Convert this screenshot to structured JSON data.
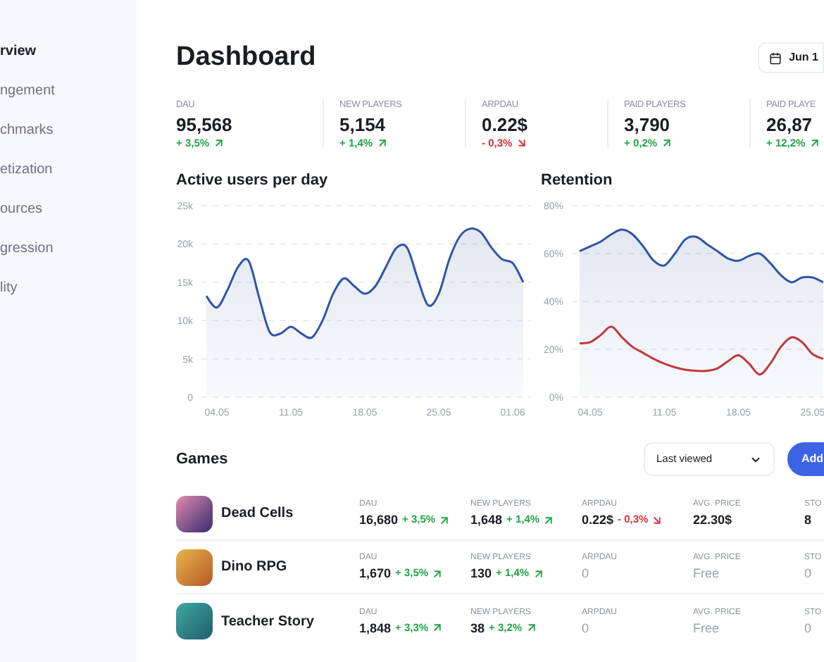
{
  "sidebar": {
    "items": [
      {
        "label": "rview",
        "selected": true
      },
      {
        "label": "ngement",
        "selected": false
      },
      {
        "label": "chmarks",
        "selected": false
      },
      {
        "label": "etization",
        "selected": false
      },
      {
        "label": "ources",
        "selected": false
      },
      {
        "label": "gression",
        "selected": false
      },
      {
        "label": "lity",
        "selected": false
      }
    ]
  },
  "header": {
    "title": "Dashboard",
    "date_button": "Jun 1"
  },
  "stats": [
    {
      "label": "DAU",
      "value": "95,568",
      "change": "+ 3,5%",
      "rising": true
    },
    {
      "label": "NEW PLAYERS",
      "value": "5,154",
      "change": "+ 1,4%",
      "rising": true
    },
    {
      "label": "ARPDAU",
      "value": "0.22$",
      "change": "- 0,3%",
      "rising": false
    },
    {
      "label": "PAID PLAYERS",
      "value": "3,790",
      "change": "+ 0,2%",
      "rising": true
    },
    {
      "label": "PAID PLAYE",
      "value": "26,87",
      "change": "+ 12,2%",
      "rising": true
    }
  ],
  "active_users": {
    "title": "Active users per day",
    "chart_data": {
      "type": "area",
      "grid": true,
      "categories": [
        null,
        "04.05",
        null,
        null,
        null,
        null,
        null,
        null,
        "11.05",
        null,
        null,
        null,
        null,
        null,
        null,
        "18.05",
        null,
        null,
        null,
        null,
        null,
        null,
        "25.05",
        null,
        null,
        null,
        null,
        null,
        null,
        "01.06",
        null
      ],
      "series": [
        {
          "color": "#2f55a4",
          "values": [
            13.2,
            11.7,
            14,
            17,
            17.8,
            13,
            8.5,
            8.3,
            9.2,
            8.3,
            7.8,
            10,
            13.5,
            15.5,
            14.5,
            13.5,
            14.5,
            17,
            19.5,
            19.5,
            15.5,
            12,
            13.5,
            18,
            21,
            22,
            21.5,
            19.5,
            18,
            17.5,
            15
          ]
        }
      ],
      "ylim": [
        0,
        25
      ],
      "yticks": [
        {
          "value": 0,
          "label": "0"
        },
        {
          "value": 5,
          "label": "5k"
        },
        {
          "value": 10,
          "label": "10k"
        },
        {
          "value": 15,
          "label": "15k"
        },
        {
          "value": 20,
          "label": "20k"
        },
        {
          "value": 25,
          "label": "25k"
        }
      ]
    }
  },
  "retention": {
    "title": "Retention",
    "chart_data": {
      "type": "area",
      "grid": true,
      "categories": [
        null,
        "04.05",
        null,
        null,
        null,
        null,
        null,
        null,
        "11.05",
        null,
        null,
        null,
        null,
        null,
        null,
        "18.05",
        null,
        null,
        null,
        null,
        null,
        null,
        "25.05",
        null
      ],
      "series": [
        {
          "color": "#2f55a4",
          "values": [
            61,
            63,
            65,
            68,
            70,
            68,
            63,
            57,
            55,
            60,
            66,
            67,
            64,
            61,
            58,
            57,
            59,
            60,
            56,
            51,
            48,
            50,
            50,
            48
          ]
        },
        {
          "color": "#c0393b",
          "type": "line",
          "values": [
            22.5,
            23,
            26,
            29.5,
            25,
            21,
            18.5,
            16,
            14,
            12.5,
            11.5,
            11,
            11,
            12,
            15,
            17.5,
            14,
            9.5,
            14,
            21,
            25,
            23,
            18,
            16
          ]
        }
      ],
      "ylim": [
        0,
        80
      ],
      "yticks": [
        {
          "value": 0,
          "label": "0%"
        },
        {
          "value": 20,
          "label": "20%"
        },
        {
          "value": 40,
          "label": "40%"
        },
        {
          "value": 60,
          "label": "60%"
        },
        {
          "value": 80,
          "label": "80%"
        }
      ]
    }
  },
  "games": {
    "title": "Games",
    "sort": {
      "value": "Last viewed"
    },
    "add_button": "Add",
    "rows": [
      {
        "name": "Dead Cells",
        "cells": [
          {
            "label": "DAU",
            "value": "16,680",
            "muted": false,
            "change": "+ 3,5%",
            "rising": true
          },
          {
            "label": "NEW PLAYERS",
            "value": "1,648",
            "muted": false,
            "change": "+ 1,4%",
            "rising": true
          },
          {
            "label": "ARPDAU",
            "value": "0.22$",
            "muted": false,
            "change": "- 0,3%",
            "rising": false
          },
          {
            "label": "AVG. PRICE",
            "value": "22.30$",
            "muted": false
          },
          {
            "label": "STO",
            "value": "8",
            "muted": false
          }
        ]
      },
      {
        "name": "Dino RPG",
        "cells": [
          {
            "label": "DAU",
            "value": "1,670",
            "muted": false,
            "change": "+ 3,5%",
            "rising": true
          },
          {
            "label": "NEW PLAYERS",
            "value": "130",
            "muted": false,
            "change": "+ 1,4%",
            "rising": true
          },
          {
            "label": "ARPDAU",
            "value": "0",
            "muted": true
          },
          {
            "label": "AVG. PRICE",
            "value": "Free",
            "muted": true
          },
          {
            "label": "STO",
            "value": "0",
            "muted": true
          }
        ]
      },
      {
        "name": "Teacher Story",
        "cells": [
          {
            "label": "DAU",
            "value": "1,848",
            "muted": false,
            "change": "+ 3,3%",
            "rising": true
          },
          {
            "label": "NEW PLAYERS",
            "value": "38",
            "muted": false,
            "change": "+ 3,2%",
            "rising": true
          },
          {
            "label": "ARPDAU",
            "value": "0",
            "muted": true
          },
          {
            "label": "AVG. PRICE",
            "value": "Free",
            "muted": true
          },
          {
            "label": "STO",
            "value": "0",
            "muted": true
          }
        ]
      }
    ]
  }
}
